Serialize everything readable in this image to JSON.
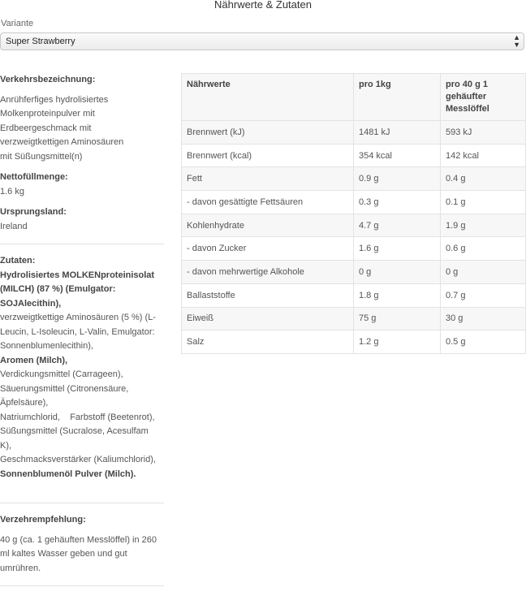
{
  "page": {
    "title": "Nährwerte & Zutaten"
  },
  "variant": {
    "label": "Variante",
    "selected": "Super Strawberry"
  },
  "left": {
    "verkehrs_heading": "Verkehrsbezeichnung:",
    "verkehrs_lines": [
      "Anrühferfiges hydrolisiertes",
      "Molkenproteinpulver mit",
      "Erdbeergeschmack mit",
      "verzweigtkettigen Aminosäuren",
      "mit Süßungsmittel(n)"
    ],
    "netto_heading": "Nettofüllmenge:",
    "netto_value": "1.6 kg",
    "ursprung_heading": "Ursprungsland:",
    "ursprung_value": "Ireland",
    "zutaten_heading": "Zutaten:",
    "zutaten_bold1": [
      "Hydrolisiertes MOLKENproteinisolat",
      "(MILCH) (87 %) (Emulgator:",
      "SOJAlecithin),"
    ],
    "zutaten_normal1": [
      "verzweigtkettige Aminosäuren (5 %) (L-",
      "Leucin, L-Isoleucin, L-Valin, Emulgator:",
      "Sonnenblumenlecithin),"
    ],
    "zutaten_bold2": [
      "Aromen (Milch),"
    ],
    "zutaten_normal2": [
      "Verdickungsmittel (Carrageen),",
      "Säuerungsmittel (Citronensäure,",
      "Äpfelsäure),",
      "Natriumchlorid,    Farbstoff (Beetenrot),",
      "Süßungsmittel (Sucralose, Acesulfam",
      "K),",
      "Geschmacksverstärker (Kaliumchlorid),"
    ],
    "zutaten_bold3": [
      "Sonnenblumenöl Pulver (Milch)."
    ],
    "verzehr_heading": "Verzehrempfehlung:",
    "verzehr_lines": [
      "40 g (ca. 1 gehäuften Messlöffel) in 260",
      "ml kaltes Wasser geben und gut",
      "umrühren."
    ]
  },
  "table": {
    "headers": [
      "Nährwerte",
      "pro 1kg",
      "pro 40 g 1\ngehäufter\nMesslöffel"
    ],
    "rows": [
      [
        "Brennwert (kJ)",
        "1481 kJ",
        "593 kJ"
      ],
      [
        "Brennwert (kcal)",
        "354 kcal",
        "142 kcal"
      ],
      [
        "Fett",
        "0.9 g",
        "0.4 g"
      ],
      [
        "- davon gesättigte Fettsäuren",
        "0.3 g",
        "0.1 g"
      ],
      [
        "Kohlenhydrate",
        "4.7 g",
        "1.9 g"
      ],
      [
        "- davon Zucker",
        "1.6 g",
        "0.6 g"
      ],
      [
        "- davon mehrwertige Alkohole",
        "0 g",
        "0 g"
      ],
      [
        "Ballaststoffe",
        "1.8 g",
        "0.7 g"
      ],
      [
        "Eiweiß",
        "75 g",
        "30 g"
      ],
      [
        "Salz",
        "1.2 g",
        "0.5 g"
      ]
    ]
  }
}
